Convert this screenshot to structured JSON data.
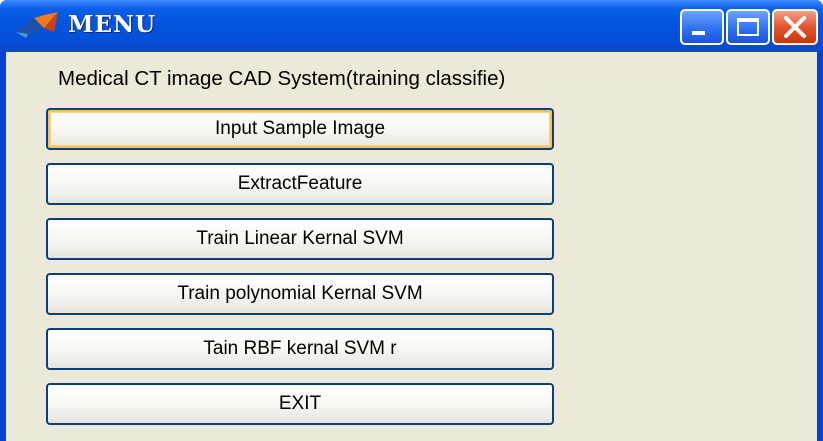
{
  "window": {
    "title": "MENU",
    "controls": [
      "minimize-icon",
      "maximize-icon",
      "close-icon"
    ]
  },
  "caption": "Medical CT image CAD System(training classifie)",
  "buttons": [
    {
      "label": "Input Sample Image",
      "focused": true
    },
    {
      "label": "ExtractFeature"
    },
    {
      "label": "Train Linear Kernal SVM"
    },
    {
      "label": "Train polynomial Kernal SVM"
    },
    {
      "label": "Tain RBF kernal SVM r"
    },
    {
      "label": "EXIT"
    }
  ],
  "colors": {
    "titlebar": "#0a5ee8",
    "client_bg": "#ece9d8",
    "button_border": "#0b3f7c",
    "focus_ring": "#f7c25a",
    "close_button": "#e0562f"
  }
}
